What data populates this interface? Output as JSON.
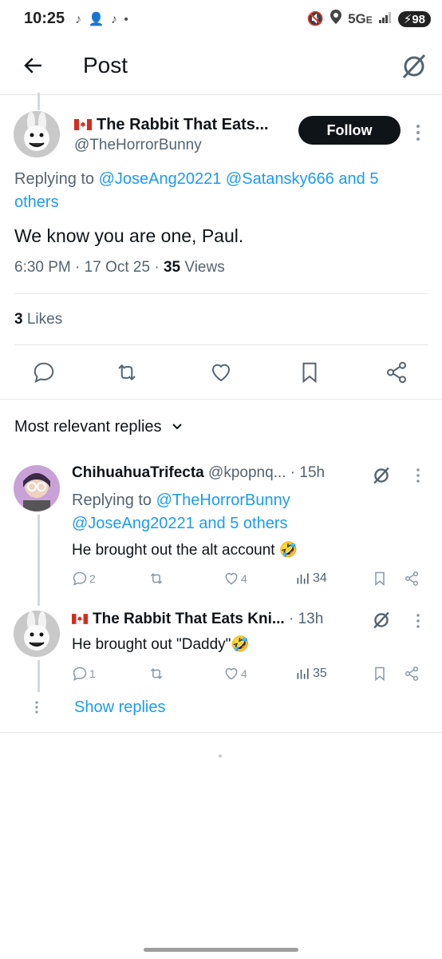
{
  "status_bar": {
    "time": "10:25",
    "network": "5G",
    "network_suffix": "E",
    "battery": "98"
  },
  "header": {
    "title": "Post"
  },
  "post": {
    "author_name": "The Rabbit That Eats...",
    "author_handle": "@TheHorrorBunny",
    "follow_label": "Follow",
    "replying_prefix": "Replying to",
    "replying_mentions": "@JoseAng20221 @Satansky666 and 5",
    "replying_mentions_line2": "others",
    "text": "We know you are one, Paul.",
    "time": "6:30 PM",
    "date": "17 Oct 25",
    "views_count": "35",
    "views_label": "Views",
    "likes_count": "3",
    "likes_label": "Likes"
  },
  "sort": {
    "label": "Most relevant replies"
  },
  "replies": [
    {
      "author_name": "ChihuahuaTrifecta",
      "author_handle": "@kpopnq...",
      "time": "15h",
      "replying_prefix": "Replying to",
      "replying_mention1": "@TheHorrorBunny",
      "replying_mention2": "@JoseAng20221 and 5 others",
      "text": "He brought out the alt account",
      "reply_count": "2",
      "like_count": "4",
      "views": "34"
    },
    {
      "author_name": "The Rabbit That Eats Kni...",
      "time": "13h",
      "text": "He brought out \"Daddy\"",
      "reply_count": "1",
      "like_count": "4",
      "views": "35"
    }
  ],
  "show_replies": "Show replies",
  "colors": {
    "accent": "#1d9bf0",
    "text": "#0f1419",
    "secondary": "#536471"
  }
}
